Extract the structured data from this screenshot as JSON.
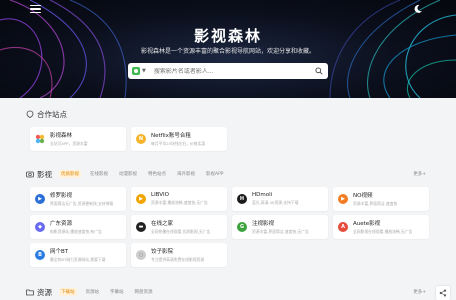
{
  "hero": {
    "title": "影视森林",
    "subtitle": "影视森林是一个资源丰富的聚合影视导航网站，欢迎分享和收藏。",
    "search_placeholder": "搜索影片名或者影人..."
  },
  "partners": {
    "title": "合作站点",
    "items": [
      {
        "name": "影视森林",
        "desc": "全站可APP，资源丰富",
        "color": "#f2a93b"
      },
      {
        "name": "Netflix账号合租",
        "desc": "每月平均20块钱左右，价格实惠",
        "color": "#f5a623"
      }
    ]
  },
  "movies": {
    "title": "影视",
    "tabs": [
      "优质影视",
      "在线影视",
      "动漫影视",
      "特色站点",
      "海外影视",
      "影视APP"
    ],
    "more": "更多+",
    "items": [
      {
        "name": "修罗影视",
        "desc": "界面简洁无广告,资源更新快,支持弹幕",
        "color": "#2b6fd6",
        "glyph": "▶"
      },
      {
        "name": "LIBVIO",
        "desc": "资源丰富,播放流畅,速度快,无广告",
        "color": "#f0a500",
        "glyph": "▶"
      },
      {
        "name": "HDmoli",
        "desc": "蓝光,高清,4K资源,支持下载",
        "color": "#1c1c1c",
        "glyph": "H"
      },
      {
        "name": "NO视频",
        "desc": "资源丰富,界面简洁,速度快",
        "color": "#f27c22",
        "glyph": "▶"
      },
      {
        "name": "广东资源",
        "desc": "电影资源站,播放速度快,有广告",
        "color": "#6a6af0",
        "glyph": "◆"
      },
      {
        "name": "在线之家",
        "desc": "全网热播在线观看,优质影视,无广告",
        "color": "#222222",
        "glyph": "▬"
      },
      {
        "name": "注视影视",
        "desc": "资源丰富,界面简洁,速度快,无广告",
        "color": "#3ca23c",
        "glyph": "G"
      },
      {
        "name": "Auete影视",
        "desc": "全网影视在线观看,播放流畅,无广告",
        "color": "#e64b3b",
        "glyph": "A"
      },
      {
        "name": "网个BT",
        "desc": "最全的BT磁力资源网站,需要下载",
        "color": "#2b7de0",
        "glyph": "B"
      },
      {
        "name": "饺子影院",
        "desc": "专注提供高清免费在线影视资源",
        "color": "#cccccc",
        "glyph": "○"
      }
    ]
  },
  "resources": {
    "title": "资源",
    "tabs": [
      "下载站",
      "资源站",
      "字幕站",
      "网盘资源"
    ],
    "more": "更多+"
  },
  "colors": {
    "accent": "#f5a623",
    "hero_bg": "#0b0f1c"
  },
  "icons": {
    "menu": "menu-icon",
    "theme": "moon-icon",
    "search": "search-icon",
    "share": "share-icon"
  }
}
